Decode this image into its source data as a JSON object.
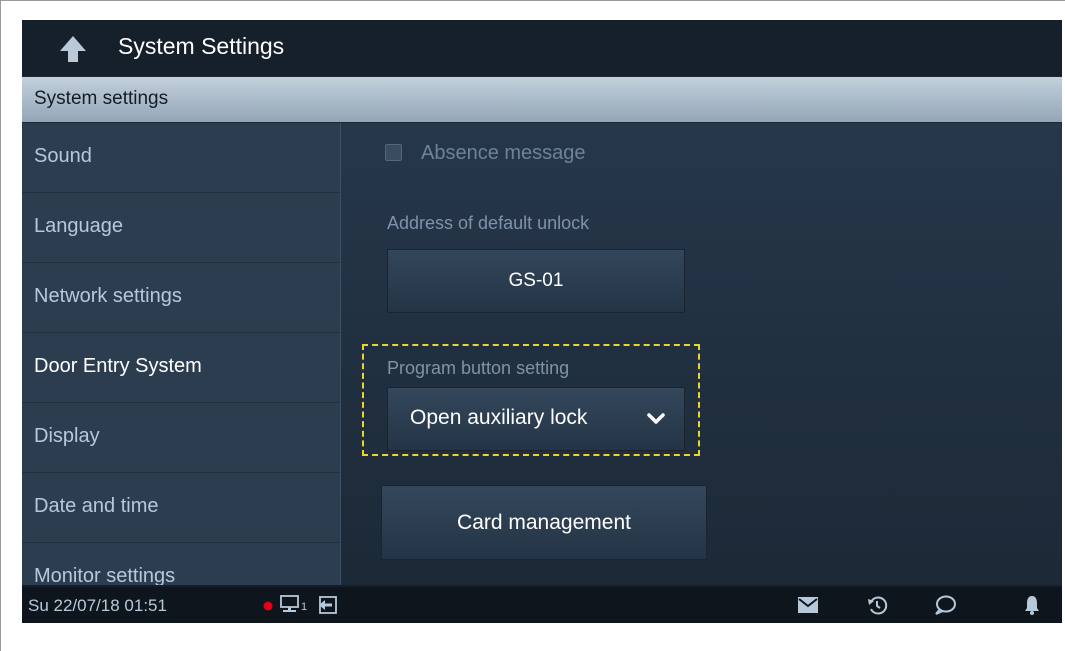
{
  "header": {
    "title": "System Settings",
    "back_icon": "back-arrow-icon"
  },
  "section": {
    "title": "System settings"
  },
  "sidebar": {
    "items": [
      {
        "label": "Sound",
        "active": false
      },
      {
        "label": "Language",
        "active": false
      },
      {
        "label": "Network settings",
        "active": false
      },
      {
        "label": "Door Entry System",
        "active": true
      },
      {
        "label": "Display",
        "active": false
      },
      {
        "label": "Date and time",
        "active": false
      },
      {
        "label": "Monitor settings",
        "active": false
      }
    ]
  },
  "content": {
    "absence_message": {
      "label": "Absence message",
      "checked": false
    },
    "default_unlock": {
      "label": "Address of default unlock",
      "value": "GS-01"
    },
    "program_button": {
      "label": "Program button setting",
      "value": "Open auxiliary lock"
    },
    "card_management": {
      "label": "Card management"
    }
  },
  "statusbar": {
    "datetime": "Su 22/07/18  01:51",
    "monitor_index": "1",
    "icons": [
      "record-dot-icon",
      "monitor-icon",
      "exit-home-icon",
      "envelope-icon",
      "history-icon",
      "chat-icon",
      "bell-icon"
    ]
  },
  "colors": {
    "accent_highlight": "#e8d62a",
    "record_dot": "#e0001a",
    "section_header": "#b0c0cf"
  }
}
